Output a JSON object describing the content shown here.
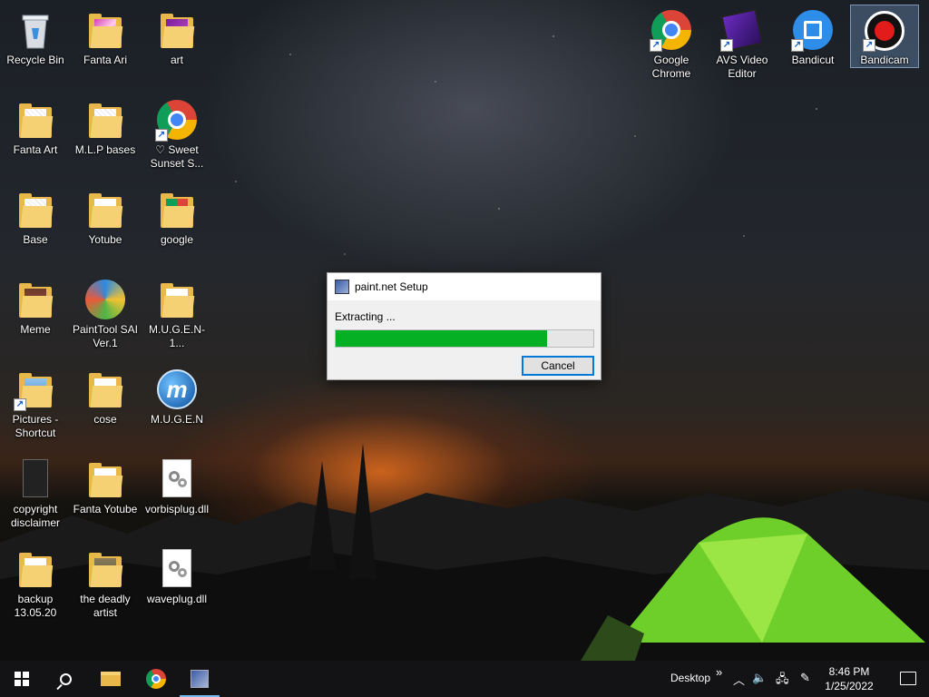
{
  "desktop": {
    "icons": [
      {
        "label": "Recycle Bin",
        "icon": "recycle-bin-icon"
      },
      {
        "label": "Fanta Ari",
        "icon": "folder-icon"
      },
      {
        "label": "art",
        "icon": "folder-icon"
      },
      {
        "label": "Fanta Art",
        "icon": "folder-icon"
      },
      {
        "label": "M.L.P bases",
        "icon": "folder-icon"
      },
      {
        "label": "♡ Sweet Sunset S...",
        "icon": "chrome-shortcut-icon"
      },
      {
        "label": "Base",
        "icon": "folder-icon"
      },
      {
        "label": "Yotube",
        "icon": "folder-icon"
      },
      {
        "label": "google",
        "icon": "folder-icon"
      },
      {
        "label": "Meme",
        "icon": "folder-icon"
      },
      {
        "label": "PaintTool SAI Ver.1",
        "icon": "painttool-sai-icon"
      },
      {
        "label": "M.U.G.E.N-1...",
        "icon": "folder-icon"
      },
      {
        "label": "Pictures - Shortcut",
        "icon": "pictures-shortcut-icon"
      },
      {
        "label": "cose",
        "icon": "folder-icon"
      },
      {
        "label": "M.U.G.E.N",
        "icon": "mugen-icon"
      },
      {
        "label": "copyright disclaimer",
        "icon": "image-file-icon"
      },
      {
        "label": "Fanta Yotube",
        "icon": "folder-icon"
      },
      {
        "label": "vorbisplug.dll",
        "icon": "dll-file-icon"
      },
      {
        "label": "backup 13.05.20",
        "icon": "folder-icon"
      },
      {
        "label": "the deadly artist",
        "icon": "folder-icon"
      },
      {
        "label": "waveplug.dll",
        "icon": "dll-file-icon"
      },
      {
        "label": "Google Chrome",
        "icon": "chrome-icon"
      },
      {
        "label": "AVS Video Editor",
        "icon": "avs-video-editor-icon"
      },
      {
        "label": "Bandicut",
        "icon": "bandicut-icon"
      },
      {
        "label": "Bandicam",
        "icon": "bandicam-icon"
      }
    ]
  },
  "dialog": {
    "title": "paint.net Setup",
    "status": "Extracting ...",
    "progress_percent": 82,
    "progress_color": "#06b025",
    "cancel_label": "Cancel"
  },
  "taskbar": {
    "desktop_label": "Desktop",
    "overflow_glyph": "»",
    "time": "8:46 PM",
    "date": "1/25/2022"
  }
}
